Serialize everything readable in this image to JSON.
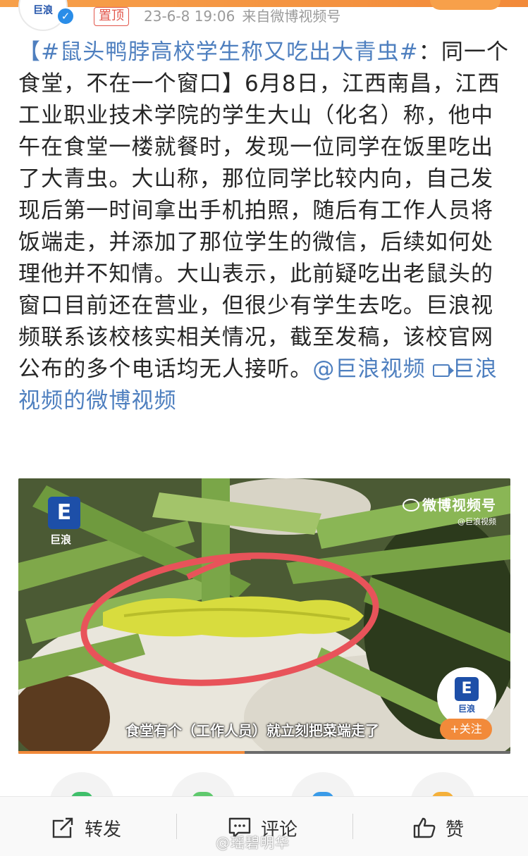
{
  "header": {
    "avatar_text": "巨浪",
    "pin_label": "置顶",
    "timestamp": "23-6-8 19:06",
    "source": "来自微博视频号"
  },
  "post": {
    "hashtag": "【#鼠头鸭脖高校学生称又吃出大青虫#",
    "body": "：同一个食堂，不在一个窗口】6月8日，江西南昌，江西工业职业技术学院的学生大山（化名）称，他中午在食堂一楼就餐时，发现一位同学在饭里吃出了大青虫。大山称，那位同学比较内向，自己发现后第一时间拿出手机拍照，随后有工作人员将饭端走，并添加了那位学生的微信，后续如何处理他并不知情。大山表示，此前疑吃出老鼠头的窗口目前还在营业，但很少有学生去吃。巨浪视频联系该校核实相关情况，截至发稿，该校官网公布的多个电话均无人接听。",
    "mention": "@巨浪视频",
    "video_link": "巨浪视频的微博视频"
  },
  "video": {
    "logo_glyph": "E",
    "logo_text": "巨浪",
    "weibo_watermark": "微博视频号",
    "weibo_sub": "@巨浪视频",
    "subtitle": "食堂有个（工作人员）就立刻把菜端走了",
    "channel_glyph": "E",
    "channel_text": "巨浪",
    "follow_label": "+关注",
    "progress": 0.46
  },
  "actions": {
    "repost": "转发",
    "comment": "评论",
    "like": "赞"
  },
  "watermark": "@瑶碧明华",
  "colors": {
    "link": "#4e7fbf",
    "accent": "#f28a3a",
    "pin": "#e2574c"
  }
}
